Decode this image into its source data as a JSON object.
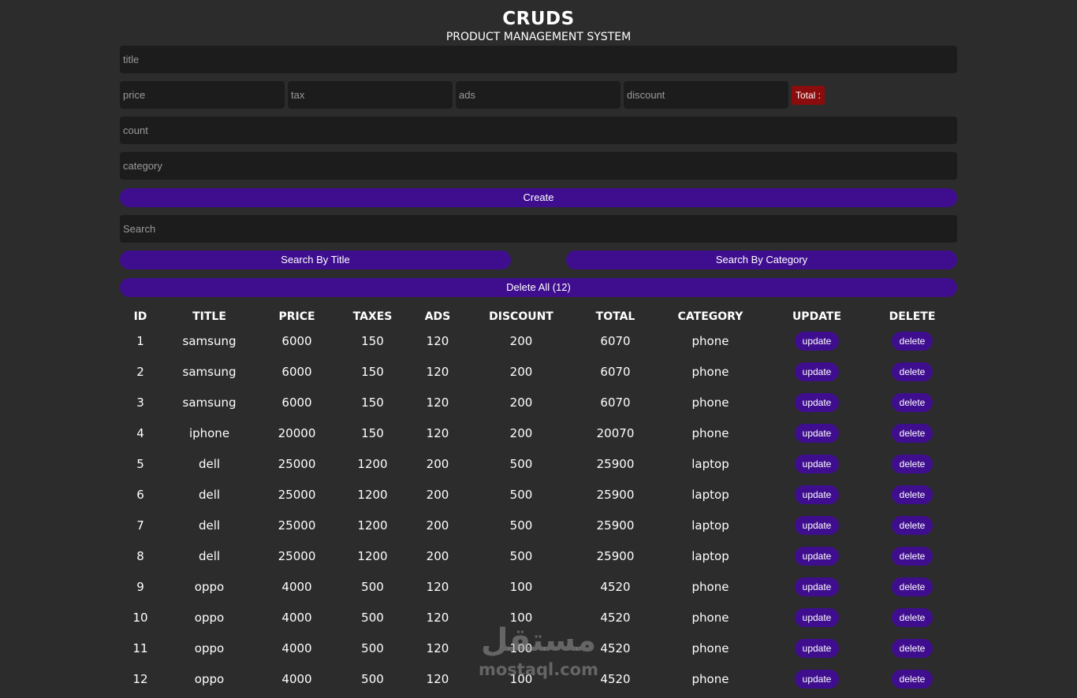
{
  "header": {
    "title": "CRUDS",
    "subtitle": "PRODUCT MANAGEMENT SYSTEM"
  },
  "form": {
    "title_placeholder": "title",
    "price_placeholder": "price",
    "tax_placeholder": "tax",
    "ads_placeholder": "ads",
    "discount_placeholder": "discount",
    "total_label": "Total :",
    "count_placeholder": "count",
    "category_placeholder": "category",
    "create_label": "Create"
  },
  "search": {
    "placeholder": "Search",
    "by_title_label": "Search By Title",
    "by_category_label": "Search By Category",
    "delete_all_label": "Delete All (12)"
  },
  "table": {
    "headers": [
      "ID",
      "TITLE",
      "PRICE",
      "TAXES",
      "ADS",
      "DISCOUNT",
      "TOTAL",
      "CATEGORY",
      "UPDATE",
      "DELETE"
    ],
    "update_label": "update",
    "delete_label": "delete",
    "rows": [
      [
        "1",
        "samsung",
        "6000",
        "150",
        "120",
        "200",
        "6070",
        "phone"
      ],
      [
        "2",
        "samsung",
        "6000",
        "150",
        "120",
        "200",
        "6070",
        "phone"
      ],
      [
        "3",
        "samsung",
        "6000",
        "150",
        "120",
        "200",
        "6070",
        "phone"
      ],
      [
        "4",
        "iphone",
        "20000",
        "150",
        "120",
        "200",
        "20070",
        "phone"
      ],
      [
        "5",
        "dell",
        "25000",
        "1200",
        "200",
        "500",
        "25900",
        "laptop"
      ],
      [
        "6",
        "dell",
        "25000",
        "1200",
        "200",
        "500",
        "25900",
        "laptop"
      ],
      [
        "7",
        "dell",
        "25000",
        "1200",
        "200",
        "500",
        "25900",
        "laptop"
      ],
      [
        "8",
        "dell",
        "25000",
        "1200",
        "200",
        "500",
        "25900",
        "laptop"
      ],
      [
        "9",
        "oppo",
        "4000",
        "500",
        "120",
        "100",
        "4520",
        "phone"
      ],
      [
        "10",
        "oppo",
        "4000",
        "500",
        "120",
        "100",
        "4520",
        "phone"
      ],
      [
        "11",
        "oppo",
        "4000",
        "500",
        "120",
        "100",
        "4520",
        "phone"
      ],
      [
        "12",
        "oppo",
        "4000",
        "500",
        "120",
        "100",
        "4520",
        "phone"
      ]
    ]
  },
  "watermark": {
    "arabic": "مستقل",
    "latin": "mostaql.com"
  },
  "colors": {
    "background": "#2c2c2c",
    "input": "#1c1c1c",
    "accent": "#3f0e8f",
    "total": "#8b0c0c"
  }
}
